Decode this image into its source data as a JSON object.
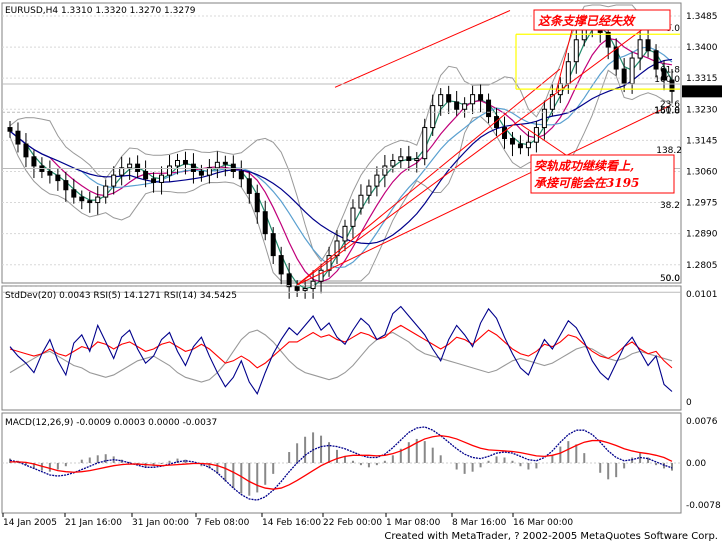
{
  "window": {
    "symbol_header": "EURUSD,H4  1.3310 1.3320 1.3270 1.3279",
    "footer": "Created with MetaTrader, ? 2002-2005 MetaQuotes Software Corp."
  },
  "annotations": {
    "support_broken": "这条支撑已经失效",
    "channel_note_line1": "突轨成功继续看上,",
    "channel_note_line2": "承接可能会在3195"
  },
  "colors": {
    "candles": "#000000",
    "channel": "#ff0000",
    "ma_slow": "#00008b",
    "ma_mid": "#5aa0d0",
    "ma_fast": "#c0007a",
    "ma_short": "#208a6a",
    "bollinger": "#999999",
    "rsi5": "#00008b",
    "rsi14": "#ff0000",
    "stddev": "#999999",
    "macd_signal": "#ff0000",
    "macd_main": "#00008b",
    "macd_hist": "#888888",
    "fibo_band": "#ffff00",
    "price_marker": "#000000"
  },
  "chart_data": [
    {
      "type": "candlestick",
      "title": "EURUSD,H4",
      "ohlc_header": [
        "1.3310",
        "1.3320",
        "1.3270",
        "1.3279"
      ],
      "ylim": [
        1.2695,
        1.3515
      ],
      "y_ticks": [
        "1.3485",
        "1.3400",
        "1.3315",
        "1.3230",
        "1.3145",
        "1.3060",
        "1.2975",
        "1.2890",
        "1.2805",
        "1.2720"
      ],
      "last_price": "1.3279",
      "x_labels": [
        "14 Jan 2005",
        "21 Jan 16:00",
        "31 Jan 00:00",
        "7 Feb 08:00",
        "14 Feb 16:00",
        "22 Feb 00:00",
        "1 Mar 08:00",
        "8 Mar 16:00",
        "16 Mar 00:00"
      ],
      "closes": [
        1.317,
        1.3135,
        1.31,
        1.3075,
        1.306,
        1.305,
        1.3035,
        1.301,
        1.299,
        1.298,
        1.2975,
        1.299,
        1.302,
        1.305,
        1.307,
        1.308,
        1.306,
        1.304,
        1.303,
        1.305,
        1.3075,
        1.309,
        1.308,
        1.306,
        1.305,
        1.307,
        1.3085,
        1.308,
        1.306,
        1.304,
        1.3,
        1.295,
        1.289,
        1.283,
        1.278,
        1.2745,
        1.2735,
        1.274,
        1.276,
        1.279,
        1.283,
        1.287,
        1.291,
        1.296,
        1.2995,
        1.302,
        1.305,
        1.3075,
        1.309,
        1.31,
        1.309,
        1.3095,
        1.318,
        1.324,
        1.327,
        1.325,
        1.323,
        1.3245,
        1.327,
        1.3255,
        1.321,
        1.318,
        1.315,
        1.3135,
        1.3125,
        1.314,
        1.318,
        1.323,
        1.327,
        1.33,
        1.336,
        1.342,
        1.345,
        1.347,
        1.344,
        1.34,
        1.334,
        1.33,
        1.337,
        1.342,
        1.339,
        1.334,
        1.331,
        1.3279
      ],
      "fibo_levels": [
        "0.0",
        "23.6",
        "38.2",
        "50.0",
        "61.8",
        "100.0"
      ],
      "fibo_range": [
        1.3435,
        1.3285
      ],
      "fibo_levels_left": [
        "61.8",
        "100.0",
        "23.6",
        "150.0",
        "161.8",
        "138.2",
        "38.2",
        "0.0",
        "50.0"
      ]
    },
    {
      "type": "line",
      "title": "StdDev(20) 0.0043  RSI(5) 14.1271  RSI(14) 34.5425",
      "y_ticks": [
        "0.0101",
        "0"
      ],
      "series": [
        {
          "name": "RSI(5)",
          "values": [
            52,
            44,
            38,
            30,
            46,
            58,
            40,
            28,
            55,
            62,
            48,
            70,
            56,
            42,
            60,
            66,
            50,
            38,
            44,
            58,
            64,
            48,
            36,
            52,
            60,
            44,
            30,
            18,
            26,
            40,
            22,
            12,
            30,
            46,
            58,
            68,
            62,
            70,
            78,
            66,
            72,
            60,
            54,
            66,
            76,
            70,
            58,
            62,
            80,
            86,
            78,
            70,
            62,
            50,
            40,
            58,
            70,
            62,
            52,
            72,
            84,
            76,
            60,
            46,
            34,
            28,
            44,
            58,
            50,
            62,
            74,
            68,
            56,
            40,
            30,
            24,
            38,
            52,
            60,
            48,
            36,
            44,
            20,
            14
          ]
        },
        {
          "name": "RSI(14)",
          "values": [
            50,
            48,
            46,
            44,
            46,
            50,
            46,
            44,
            48,
            52,
            50,
            56,
            54,
            50,
            54,
            56,
            52,
            48,
            50,
            54,
            56,
            52,
            48,
            50,
            54,
            50,
            44,
            38,
            40,
            44,
            40,
            34,
            38,
            44,
            50,
            56,
            56,
            60,
            64,
            60,
            62,
            58,
            56,
            60,
            64,
            62,
            58,
            60,
            66,
            70,
            66,
            62,
            58,
            54,
            50,
            54,
            60,
            58,
            54,
            60,
            66,
            62,
            56,
            50,
            46,
            44,
            48,
            54,
            52,
            56,
            62,
            60,
            54,
            48,
            44,
            42,
            46,
            52,
            56,
            50,
            46,
            48,
            40,
            34
          ]
        },
        {
          "name": "StdDev(20)",
          "values": [
            30,
            34,
            38,
            42,
            46,
            48,
            44,
            40,
            36,
            34,
            30,
            28,
            26,
            28,
            32,
            36,
            40,
            42,
            44,
            40,
            36,
            30,
            26,
            24,
            22,
            24,
            30,
            38,
            48,
            58,
            64,
            66,
            62,
            56,
            48,
            40,
            34,
            30,
            28,
            26,
            24,
            26,
            30,
            36,
            44,
            52,
            58,
            62,
            64,
            60,
            56,
            50,
            46,
            44,
            42,
            40,
            38,
            36,
            34,
            32,
            30,
            32,
            36,
            40,
            42,
            40,
            38,
            36,
            38,
            42,
            46,
            50,
            52,
            50,
            46,
            42,
            40,
            42,
            46,
            48,
            46,
            44,
            42,
            40
          ]
        }
      ]
    },
    {
      "type": "bar",
      "title": "MACD(12,26,9) -0.0009 0.0003 0.0000 -0.0037",
      "y_ticks": [
        "0.0076",
        "0.00",
        "-0.0078"
      ],
      "ylim": [
        -0.0088,
        0.0086
      ],
      "macd_hist": [
        0.0008,
        0.0004,
        -0.0004,
        -0.001,
        -0.0014,
        -0.0016,
        -0.0012,
        -0.0006,
        0.0,
        0.0006,
        0.001,
        0.0014,
        0.0016,
        0.0012,
        0.0006,
        0.0002,
        -0.0004,
        -0.0008,
        -0.0006,
        -0.0002,
        0.0004,
        0.0008,
        0.0006,
        0.0,
        -0.0006,
        -0.001,
        -0.002,
        -0.0034,
        -0.0046,
        -0.0056,
        -0.006,
        -0.0054,
        -0.004,
        -0.002,
        0.0,
        0.002,
        0.0036,
        0.0048,
        0.0056,
        0.005,
        0.0038,
        0.0024,
        0.0012,
        0.0004,
        -0.0004,
        -0.0008,
        -0.0004,
        0.0004,
        0.0014,
        0.0026,
        0.0038,
        0.0044,
        0.004,
        0.0028,
        0.0014,
        0.0,
        -0.0012,
        -0.002,
        -0.0016,
        -0.0008,
        0.0004,
        0.0012,
        0.001,
        0.0004,
        -0.0006,
        -0.0012,
        -0.001,
        0.0,
        0.0014,
        0.003,
        0.004,
        0.0034,
        0.0018,
        0.0,
        -0.0018,
        -0.003,
        -0.0026,
        -0.001,
        0.001,
        0.0018,
        0.001,
        -0.0004,
        -0.001,
        -0.0014
      ],
      "series": [
        {
          "name": "MACD main",
          "values": [
            0.0005,
            0.0002,
            -0.0004,
            -0.001,
            -0.0016,
            -0.0022,
            -0.0024,
            -0.0022,
            -0.0018,
            -0.0012,
            -0.0006,
            0.0,
            0.0004,
            0.0006,
            0.0004,
            0.0,
            -0.0004,
            -0.0008,
            -0.0008,
            -0.0006,
            -0.0002,
            0.0002,
            0.0004,
            0.0002,
            -0.0002,
            -0.0008,
            -0.0018,
            -0.0032,
            -0.0046,
            -0.0058,
            -0.0066,
            -0.0068,
            -0.0062,
            -0.005,
            -0.0034,
            -0.0016,
            0.0,
            0.0014,
            0.0024,
            0.003,
            0.0032,
            0.003,
            0.0026,
            0.002,
            0.0014,
            0.001,
            0.001,
            0.0016,
            0.0028,
            0.0042,
            0.0056,
            0.0064,
            0.0066,
            0.006,
            0.005,
            0.0038,
            0.0026,
            0.0016,
            0.001,
            0.0008,
            0.0012,
            0.0018,
            0.002,
            0.0018,
            0.0012,
            0.0006,
            0.0004,
            0.001,
            0.0022,
            0.0038,
            0.0052,
            0.006,
            0.006,
            0.0052,
            0.0038,
            0.0022,
            0.001,
            0.0004,
            0.0006,
            0.001,
            0.0008,
            0.0002,
            -0.0004,
            -0.0009
          ]
        },
        {
          "name": "MACD signal",
          "values": [
            0.0002,
            0.0002,
            0.0001,
            -0.0002,
            -0.0006,
            -0.001,
            -0.0014,
            -0.0016,
            -0.0017,
            -0.0016,
            -0.0014,
            -0.0011,
            -0.0008,
            -0.0005,
            -0.0003,
            -0.0002,
            -0.0002,
            -0.0003,
            -0.0004,
            -0.0005,
            -0.0004,
            -0.0003,
            -0.0002,
            -0.0001,
            -0.0001,
            -0.0002,
            -0.0005,
            -0.001,
            -0.0017,
            -0.0025,
            -0.0034,
            -0.0041,
            -0.0046,
            -0.0048,
            -0.0046,
            -0.004,
            -0.0032,
            -0.0023,
            -0.0014,
            -0.0005,
            0.0002,
            0.0008,
            0.0012,
            0.0014,
            0.0014,
            0.0014,
            0.0013,
            0.0014,
            0.0017,
            0.0022,
            0.0029,
            0.0037,
            0.0044,
            0.0048,
            0.005,
            0.0048,
            0.0044,
            0.0038,
            0.0032,
            0.0027,
            0.0024,
            0.0023,
            0.0022,
            0.0021,
            0.0019,
            0.0016,
            0.0013,
            0.0012,
            0.0014,
            0.0018,
            0.0025,
            0.0032,
            0.0038,
            0.0041,
            0.0041,
            0.0037,
            0.0032,
            0.0026,
            0.0022,
            0.0019,
            0.0017,
            0.0014,
            0.001,
            0.0003
          ]
        }
      ]
    }
  ]
}
